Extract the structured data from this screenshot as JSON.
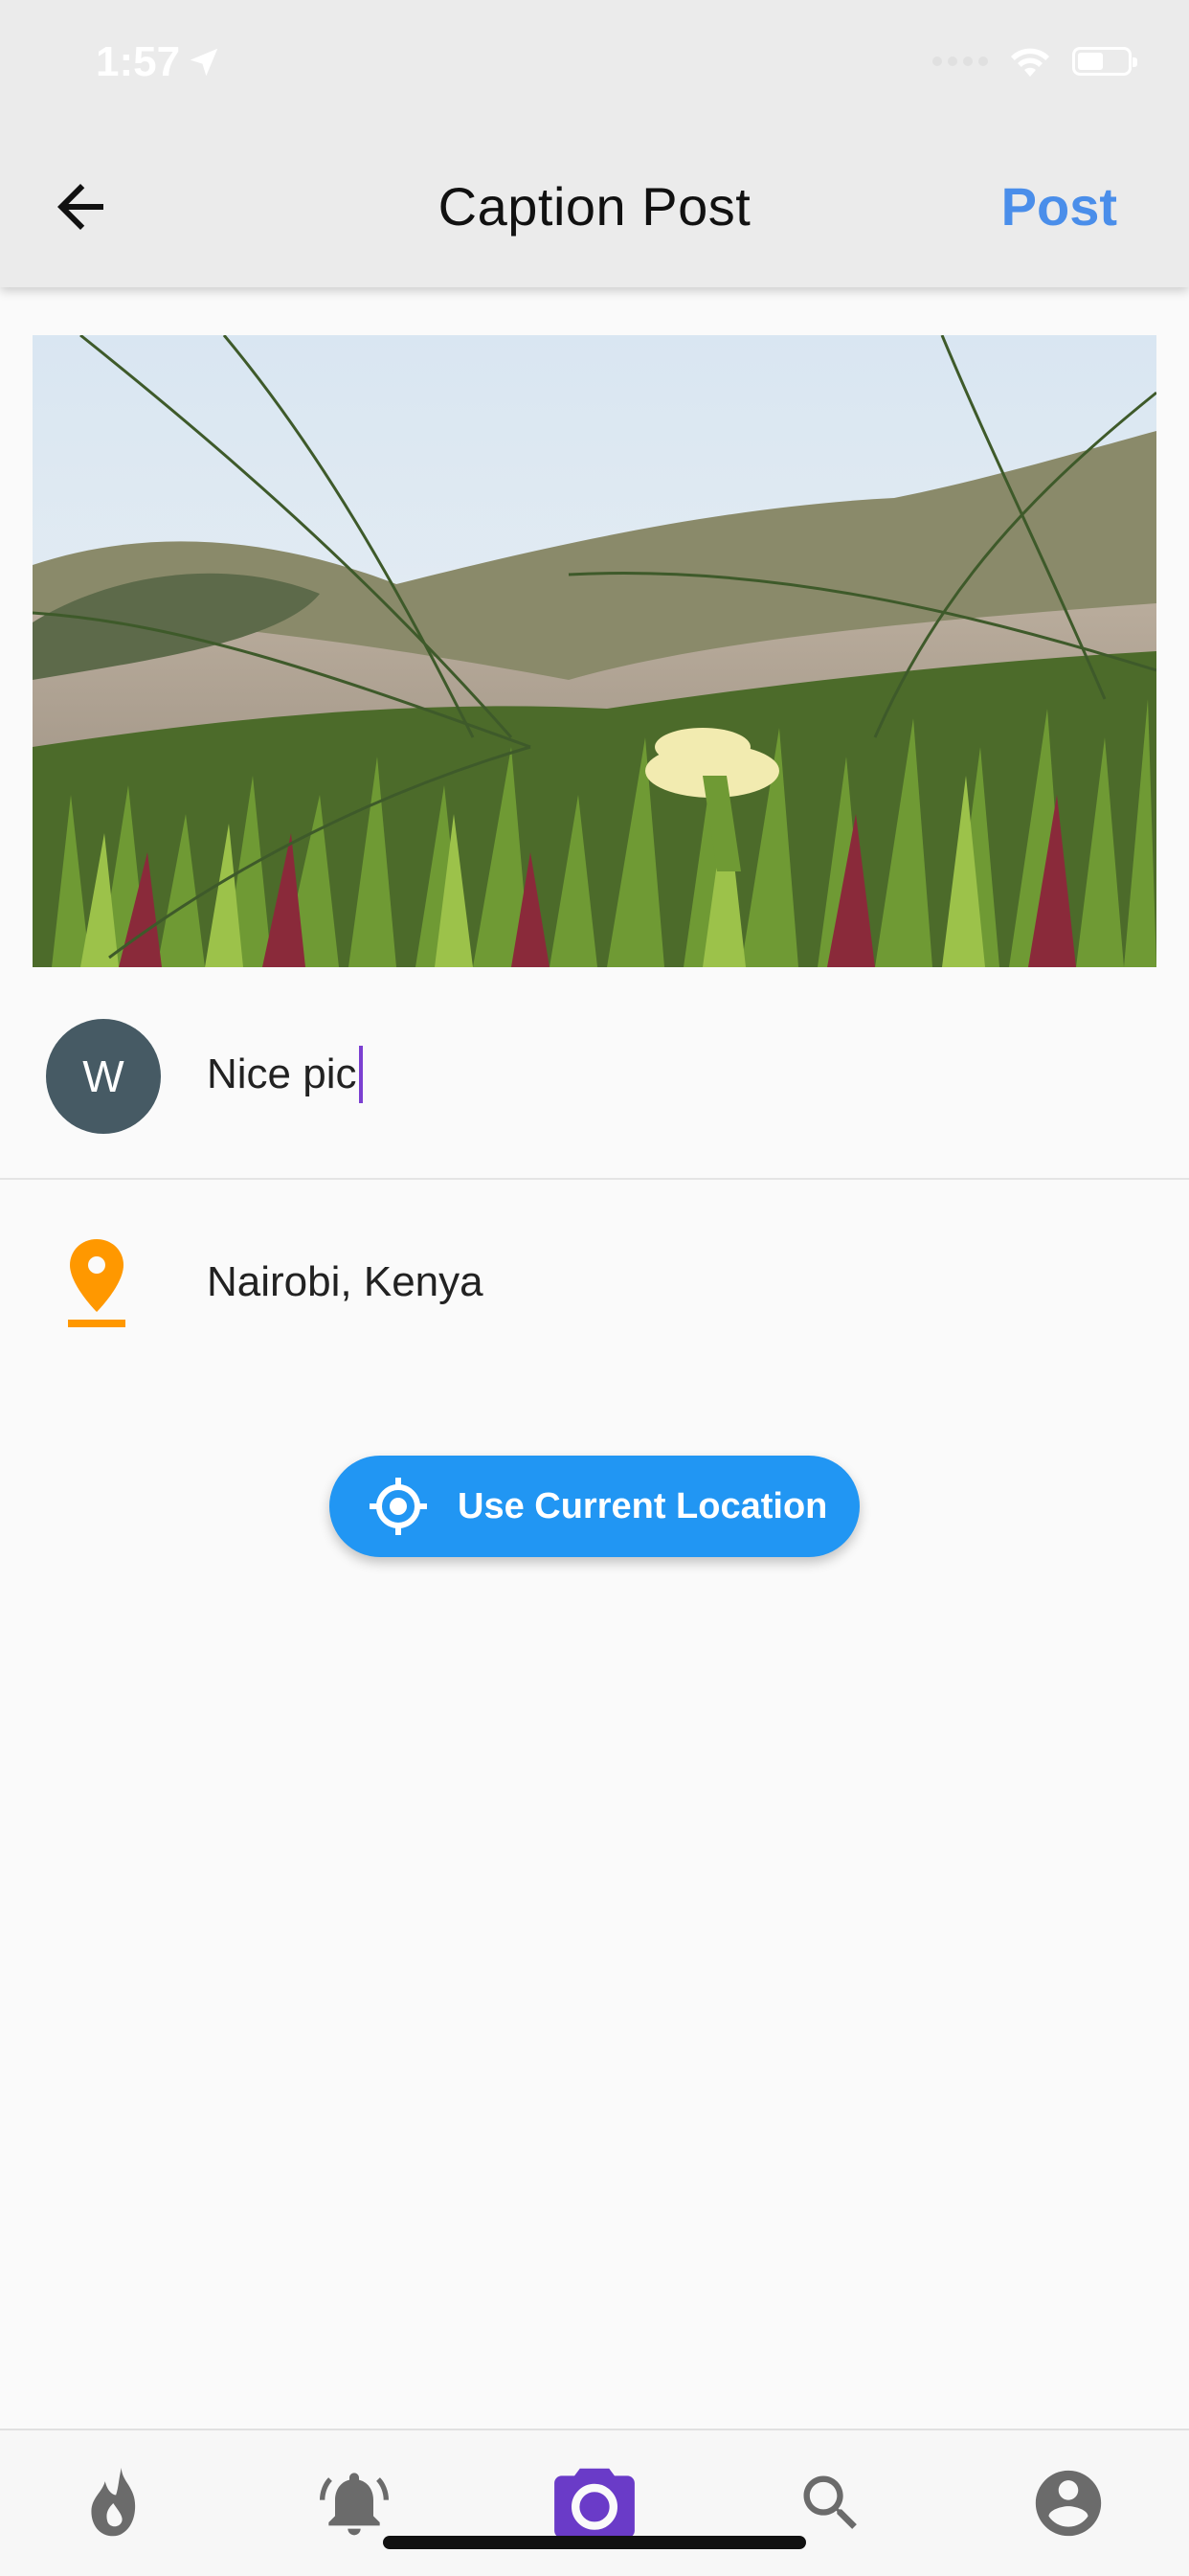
{
  "status_bar": {
    "time": "1:57"
  },
  "app_bar": {
    "title": "Caption Post",
    "post_label": "Post"
  },
  "caption": {
    "avatar_initial": "W",
    "text": "Nice pic"
  },
  "location": {
    "text": "Nairobi, Kenya"
  },
  "current_location_button": {
    "label": "Use Current Location"
  },
  "bottom_nav": {
    "items": [
      {
        "icon": "flame-icon"
      },
      {
        "icon": "bell-icon"
      },
      {
        "icon": "camera-icon",
        "active": true
      },
      {
        "icon": "search-icon"
      },
      {
        "icon": "account-icon"
      }
    ]
  },
  "colors": {
    "accent": "#4a8eea",
    "button": "#2196f3",
    "active_nav": "#6a3bc8",
    "location_pin": "#ff9800",
    "avatar": "#465a64"
  }
}
